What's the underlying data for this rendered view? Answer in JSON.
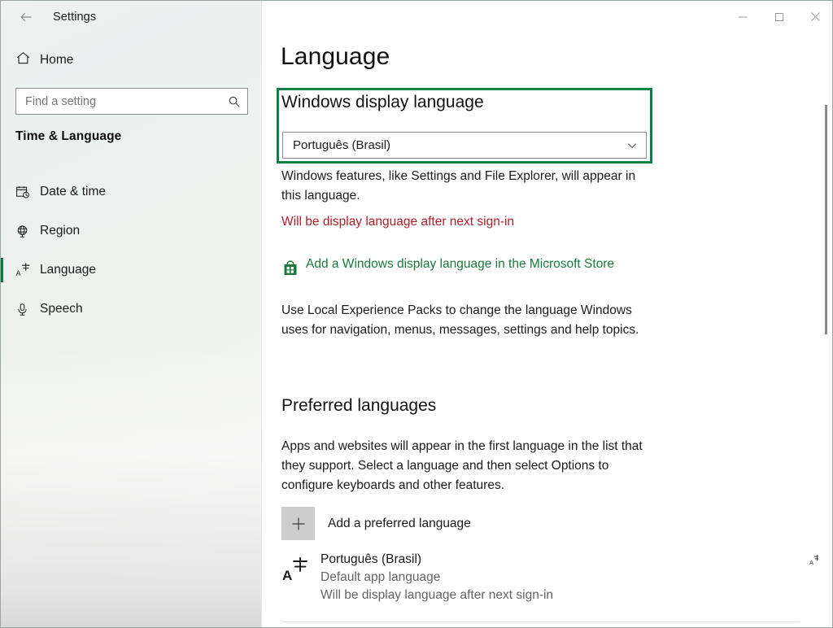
{
  "window": {
    "title": "Settings",
    "back_icon": "back-arrow-icon",
    "minimize_label": "Minimize",
    "maximize_label": "Maximize",
    "close_label": "Close"
  },
  "sidebar": {
    "home": {
      "label": "Home",
      "icon": "home-icon"
    },
    "search": {
      "placeholder": "Find a setting",
      "value": "",
      "icon": "search-icon"
    },
    "category_title": "Time & Language",
    "items": [
      {
        "label": "Date & time",
        "icon": "calendar-clock-icon",
        "selected": false
      },
      {
        "label": "Region",
        "icon": "globe-icon",
        "selected": false
      },
      {
        "label": "Language",
        "icon": "language-icon",
        "selected": true
      },
      {
        "label": "Speech",
        "icon": "microphone-icon",
        "selected": false
      }
    ]
  },
  "main": {
    "page_title": "Language",
    "display_language": {
      "heading": "Windows display language",
      "selected": "Português (Brasil)",
      "chevron_icon": "chevron-down-icon",
      "description": "Windows features, like Settings and File Explorer, will appear in this language.",
      "warning": "Will be display language after next sign-in",
      "store_link": "Add a Windows display language in the Microsoft Store",
      "store_icon": "microsoft-store-bag-icon",
      "store_description": "Use Local Experience Packs to change the language Windows uses for navigation, menus, messages, settings and help topics."
    },
    "preferred_languages": {
      "heading": "Preferred languages",
      "description": "Apps and websites will appear in the first language in the list that they support. Select a language and then select Options to configure keyboards and other features.",
      "add_button": {
        "label": "Add a preferred language",
        "icon": "plus-icon"
      },
      "entries": [
        {
          "name": "Português (Brasil)",
          "sub1": "Default app language",
          "sub2": "Will be display language after next sign-in",
          "icon": "language-pack-icon",
          "features": [
            "language-pack-icon",
            "display-language-icon",
            "speech-microphone-icon",
            "handwriting-pen-icon",
            "keyboard-icon"
          ]
        }
      ]
    }
  },
  "colors": {
    "highlight_green": "#0f8043",
    "selection_green": "#0f7b43",
    "link_green": "#1b7a3d",
    "warning_red": "#b0202a"
  }
}
